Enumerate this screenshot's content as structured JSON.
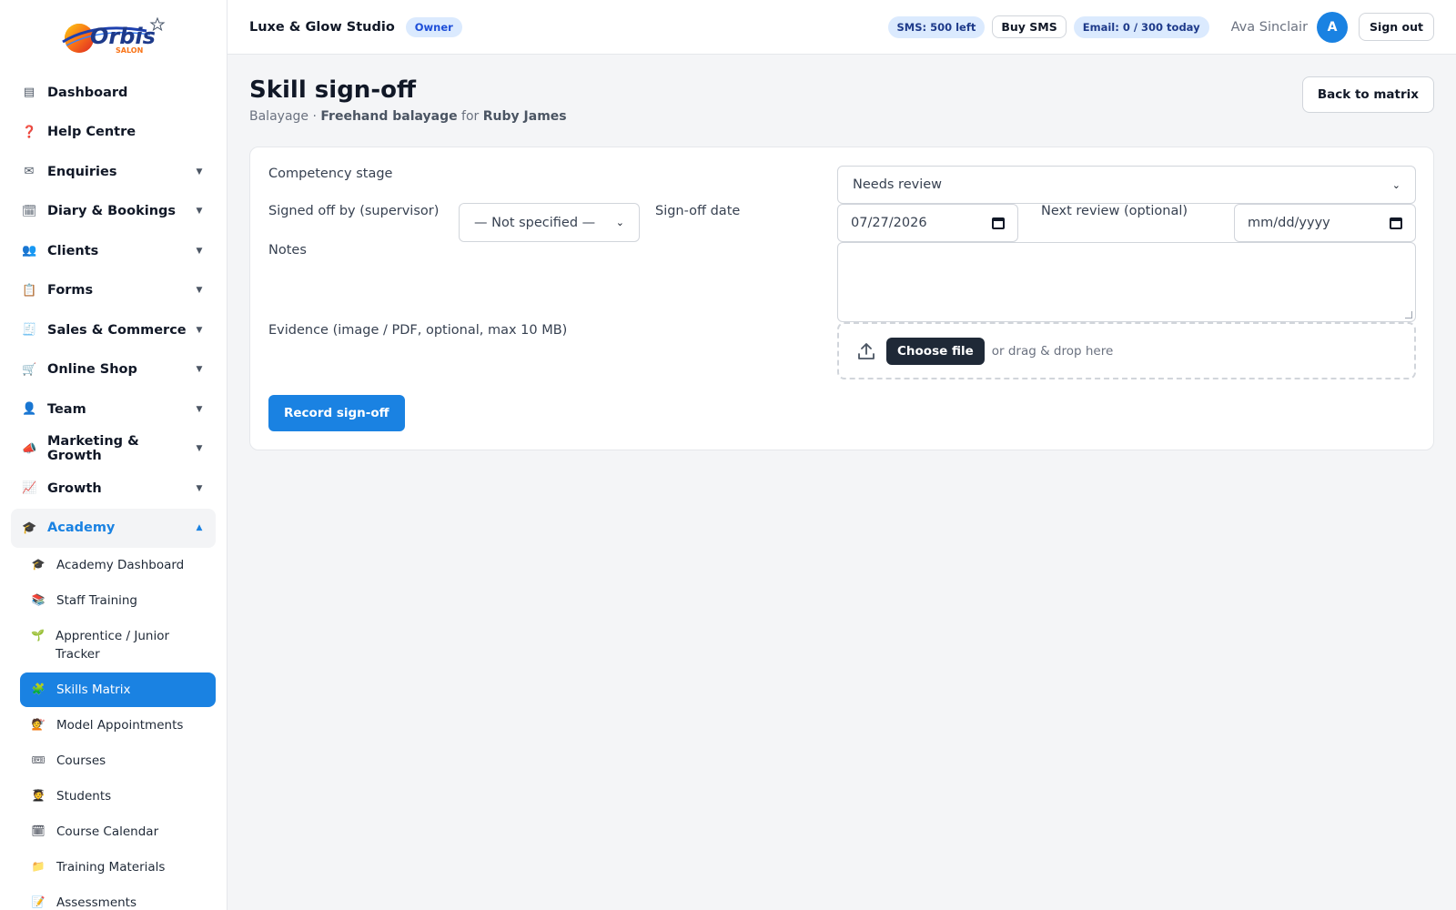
{
  "brand": {
    "logo_text": "Orbis",
    "logo_sub": "SALON"
  },
  "sidebar": {
    "items": [
      {
        "label": "Dashboard",
        "icon": "dashboard-icon",
        "glyph": "▤"
      },
      {
        "label": "Help Centre",
        "icon": "question-icon",
        "glyph": "❓"
      },
      {
        "label": "Enquiries",
        "icon": "envelope-icon",
        "glyph": "✉"
      },
      {
        "label": "Diary & Bookings",
        "icon": "calendar-icon",
        "glyph": "🗓"
      },
      {
        "label": "Clients",
        "icon": "people-icon",
        "glyph": "👥"
      },
      {
        "label": "Forms",
        "icon": "clipboard-icon",
        "glyph": "📋"
      },
      {
        "label": "Sales & Commerce",
        "icon": "receipt-icon",
        "glyph": "🧾"
      },
      {
        "label": "Online Shop",
        "icon": "cart-icon",
        "glyph": "🛒"
      },
      {
        "label": "Team",
        "icon": "person-icon",
        "glyph": "👤"
      },
      {
        "label": "Marketing & Growth",
        "icon": "megaphone-icon",
        "glyph": "📣"
      },
      {
        "label": "Growth",
        "icon": "chart-up-icon",
        "glyph": "📈"
      },
      {
        "label": "Academy",
        "icon": "graduation-cap-icon",
        "glyph": "🎓"
      }
    ],
    "chevron_down": "▼",
    "chevron_up": "▲",
    "academy_sub": [
      {
        "label": "Academy Dashboard",
        "icon": "graduation-cap-icon",
        "glyph": "🎓"
      },
      {
        "label": "Staff Training",
        "icon": "books-icon",
        "glyph": "📚"
      },
      {
        "label": "Apprentice / Junior Tracker",
        "icon": "seedling-icon",
        "glyph": "🌱"
      },
      {
        "label": "Skills Matrix",
        "icon": "puzzle-icon",
        "glyph": "🧩"
      },
      {
        "label": "Model Appointments",
        "icon": "haircut-icon",
        "glyph": "💇"
      },
      {
        "label": "Courses",
        "icon": "ticket-icon",
        "glyph": "🎟"
      },
      {
        "label": "Students",
        "icon": "student-icon",
        "glyph": "🧑‍🎓"
      },
      {
        "label": "Course Calendar",
        "icon": "calendar-icon",
        "glyph": "🗓"
      },
      {
        "label": "Training Materials",
        "icon": "folder-icon",
        "glyph": "📁"
      },
      {
        "label": "Assessments",
        "icon": "memo-icon",
        "glyph": "📝"
      }
    ]
  },
  "header": {
    "studio": "Luxe & Glow Studio",
    "role": "Owner",
    "sms": "SMS: 500 left",
    "buy_sms": "Buy SMS",
    "email": "Email: 0 / 300 today",
    "user": "Ava Sinclair",
    "avatar_initial": "A",
    "sign_out": "Sign out"
  },
  "page": {
    "title": "Skill sign-off",
    "category": "Balayage",
    "separator": " · ",
    "skill": "Freehand balayage",
    "for_word": " for ",
    "person": "Ruby James",
    "back_button": "Back to matrix"
  },
  "form": {
    "stage_label": "Competency stage",
    "stage_value": "Needs review",
    "supervisor_label": "Signed off by (supervisor)",
    "supervisor_value": "— Not specified —",
    "date_label": "Sign-off date",
    "date_value": "07/27/2026",
    "next_review_label": "Next review (optional)",
    "next_review_placeholder": "mm/dd/yyyy",
    "notes_label": "Notes",
    "notes_value": "",
    "evidence_label": "Evidence (image / PDF, optional, max 10 MB)",
    "choose_file": "Choose file",
    "drag_text": "or drag & drop here",
    "submit": "Record sign-off"
  }
}
